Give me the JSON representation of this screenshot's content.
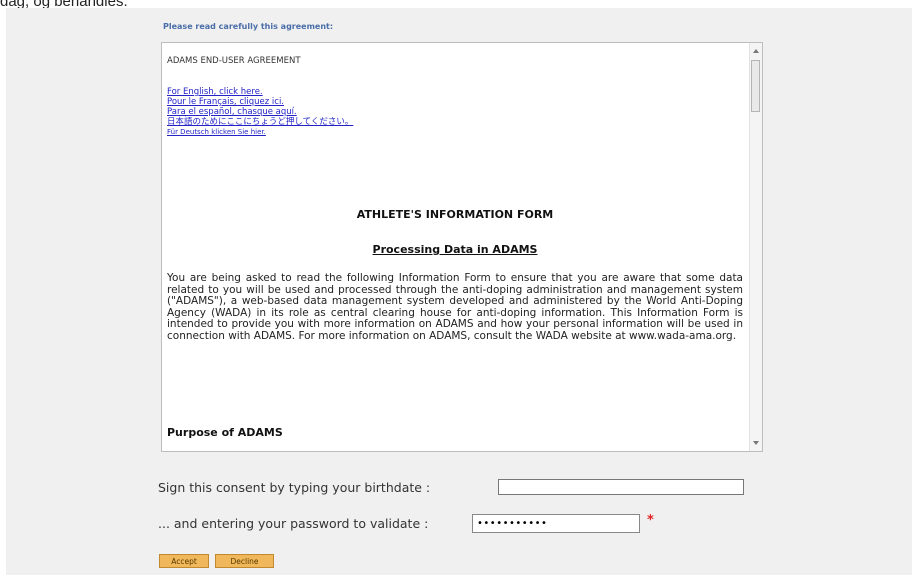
{
  "caption": "dag, og behandles.",
  "agreement": {
    "prompt": "Please read carefully this agreement:",
    "heading": "ADAMS END-USER AGREEMENT",
    "language_links": [
      "For English, click here.",
      "Pour le Français, cliquez ici.",
      "Para el español, chasque aquí.",
      "日本語のためにここにちょうど押してください。",
      "Für Deutsch klicken Sie hier."
    ],
    "form_title": "ATHLETE'S INFORMATION FORM",
    "form_subtitle": "Processing Data in ADAMS",
    "intro_paragraph": "You are being asked to read the following Information Form to ensure that you are aware that some data related to you will be used and processed through the anti-doping administration and management system (\"ADAMS\"), a web-based data management system developed and administered by the World Anti-Doping Agency (WADA) in its role as central clearing house for anti-doping information. This Information Form is intended to provide you with more information on ADAMS and how your personal information will be used in connection with ADAMS. For more information on ADAMS, consult the WADA website at www.wada-ama.org.",
    "section_title": "Purpose of ADAMS"
  },
  "consent": {
    "birthdate_label": "Sign this consent by typing your birthdate :",
    "birthdate_value": "",
    "password_label": "... and entering your password to validate :",
    "password_value": "•••••••••••",
    "required_marker": "*"
  },
  "buttons": {
    "accept": "Accept",
    "decline": "Decline"
  },
  "colors": {
    "panel_bg": "#f0f0f0",
    "link": "#2323c8",
    "prompt": "#4a6ea8",
    "button_bg": "#f0b85a",
    "required": "#e02020"
  }
}
